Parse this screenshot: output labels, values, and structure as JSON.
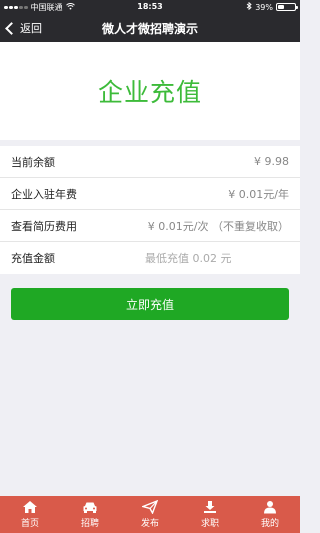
{
  "status_bar": {
    "carrier": "中国联通",
    "time": "18:53",
    "battery_percent": "39%",
    "battery_level": 0.39
  },
  "nav": {
    "back_label": "返回",
    "title": "微人才微招聘演示"
  },
  "page_heading": "企业充值",
  "rows": [
    {
      "label": "当前余额",
      "value": "¥ 9.98"
    },
    {
      "label": "企业入驻年费",
      "value": "¥ 0.01元/年"
    },
    {
      "label": "查看简历费用",
      "value": "¥ 0.01元/次 （不重复收取）"
    },
    {
      "label": "充值金额",
      "placeholder": "最低充值 0.02 元"
    }
  ],
  "primary_button": "立即充值",
  "tabbar": [
    {
      "label": "首页",
      "icon": "home-icon"
    },
    {
      "label": "招聘",
      "icon": "car-icon"
    },
    {
      "label": "发布",
      "icon": "send-icon"
    },
    {
      "label": "求职",
      "icon": "download-icon"
    },
    {
      "label": "我的",
      "icon": "user-icon"
    }
  ],
  "colors": {
    "accent_green": "#1fa824",
    "heading_green": "#3dbb3a",
    "tabbar_red": "#d95a4a",
    "topbar": "#2a2a2e"
  }
}
